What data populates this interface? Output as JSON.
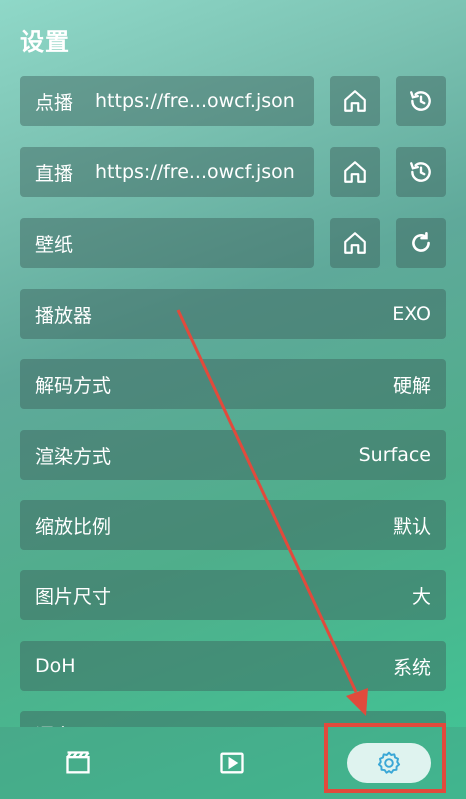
{
  "page": {
    "title": "设置"
  },
  "rows": {
    "vod": {
      "label": "点播",
      "url": "https://fre...owcf.json"
    },
    "live": {
      "label": "直播",
      "url": "https://fre...owcf.json"
    },
    "wallpaper": {
      "label": "壁纸"
    },
    "player": {
      "label": "播放器",
      "value": "EXO"
    },
    "decode": {
      "label": "解码方式",
      "value": "硬解"
    },
    "render": {
      "label": "渲染方式",
      "value": "Surface"
    },
    "scale": {
      "label": "缩放比例",
      "value": "默认"
    },
    "image_size": {
      "label": "图片尺寸",
      "value": "大"
    },
    "doh": {
      "label": "DoH",
      "value": "系统"
    },
    "partial": {
      "label": "语言"
    }
  },
  "icons": {
    "home": "home-icon",
    "history": "history-icon",
    "refresh": "refresh-icon",
    "film": "film-icon",
    "play": "play-icon",
    "settings": "settings-gear-icon"
  },
  "colors": {
    "accent": "#3aa7d6",
    "highlight_box": "#e14a3c",
    "nav_active_bg": "#dff3ef"
  }
}
